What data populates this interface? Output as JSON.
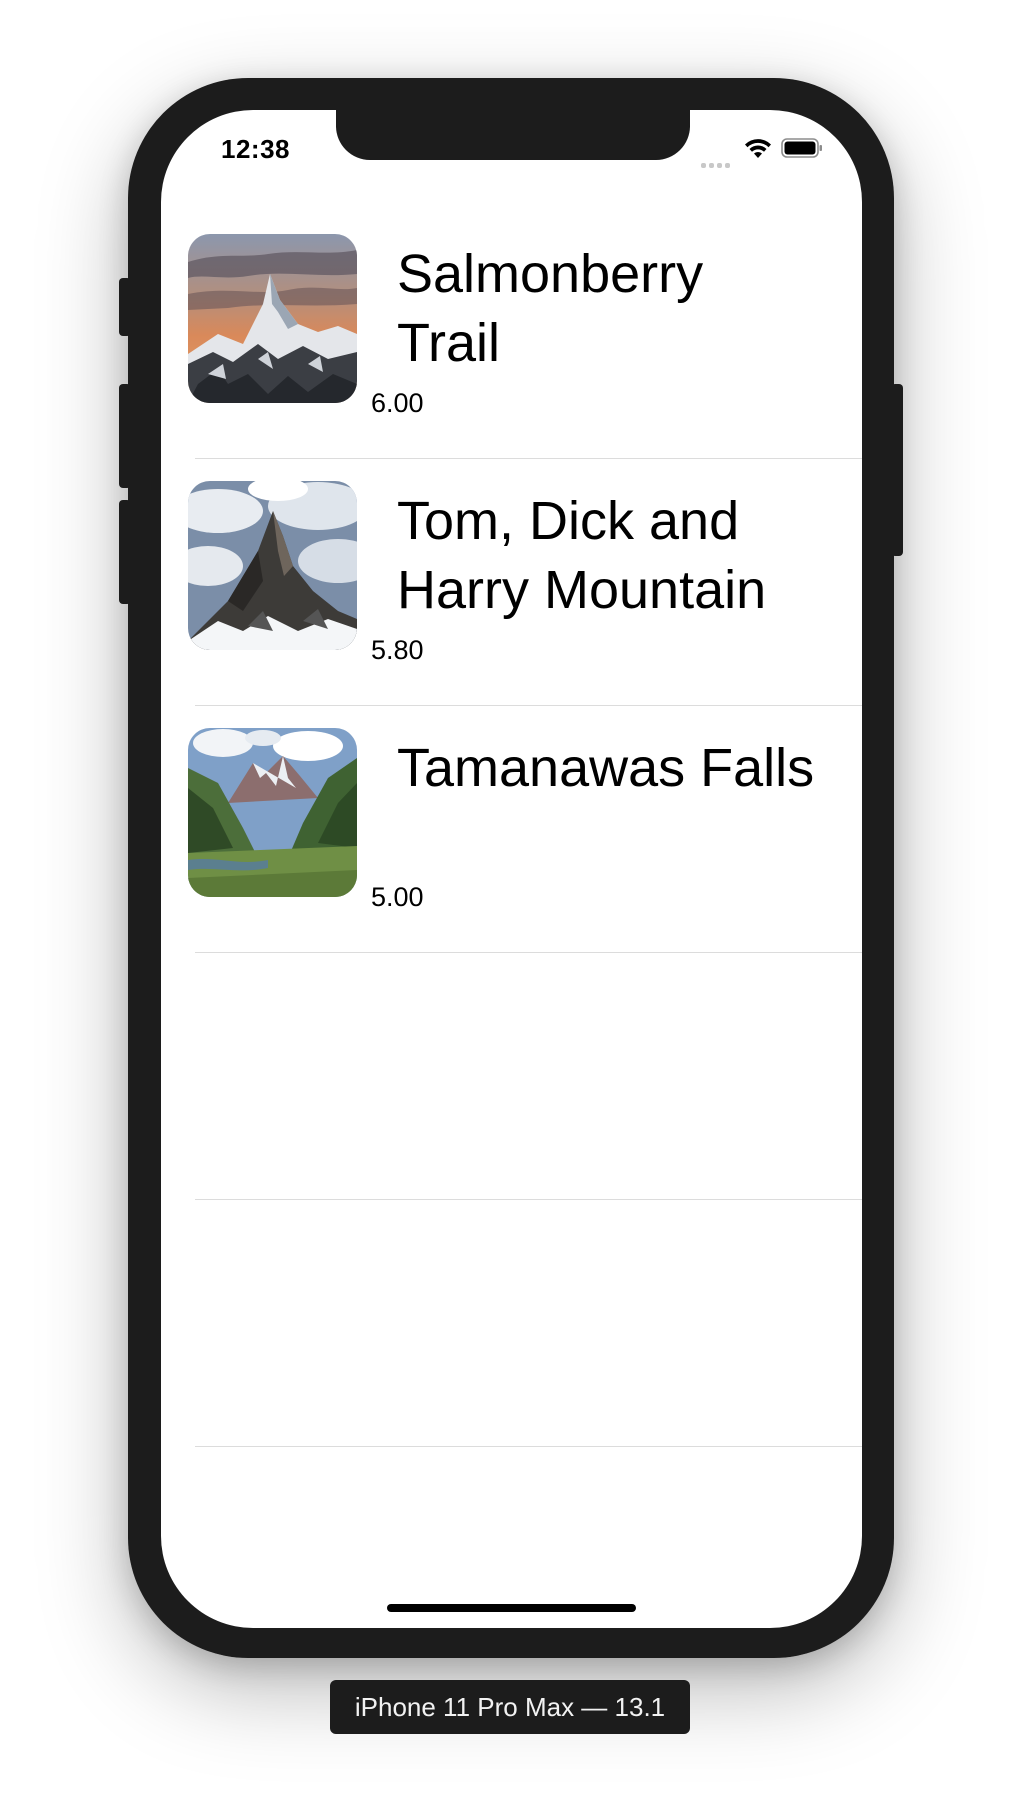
{
  "status_bar": {
    "time": "12:38",
    "icons": [
      "cellular-signal-icon",
      "wifi-icon",
      "battery-icon"
    ]
  },
  "trails": [
    {
      "title": "Salmonberry Trail",
      "rating": "6.00",
      "thumbnail": "mountain-sunset-thumbnail"
    },
    {
      "title": "Tom, Dick and Harry Mountain",
      "rating": "5.80",
      "thumbnail": "matterhorn-thumbnail"
    },
    {
      "title": "Tamanawas Falls",
      "rating": "5.00",
      "thumbnail": "valley-lake-thumbnail"
    }
  ],
  "simulator": {
    "device_label": "iPhone 11 Pro Max — 13.1"
  },
  "colors": {
    "device_frame": "#1c1c1c",
    "separator": "#dcdcdc",
    "text": "#000000"
  }
}
